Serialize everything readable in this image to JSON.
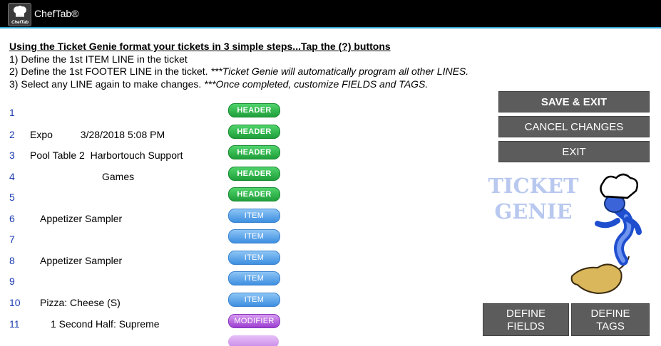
{
  "app": {
    "title": "ChefTab®",
    "icon_label": "ChefTab"
  },
  "instructions": {
    "heading": "Using the Ticket Genie format your tickets in 3 simple steps...Tap the (?) buttons",
    "line1": "1) Define the 1st ITEM LINE in the ticket",
    "line2_main": "2) Define the 1st FOOTER LINE in the ticket. ",
    "line2_italic": "***Ticket Genie will automatically program all other LINES.",
    "line3_main": "3) Select any LINE again to make changes. ",
    "line3_italic": "***Once completed, customize FIELDS and TAGS."
  },
  "rows": [
    {
      "num": "1",
      "text": "",
      "tag": "HEADER"
    },
    {
      "num": "2",
      "text": "Expo          3/28/2018 5:08 PM",
      "tag": "HEADER"
    },
    {
      "num": "3",
      "text": "Pool Table 2  Harbortouch Support",
      "tag": "HEADER"
    },
    {
      "num": "4",
      "text": "Games",
      "tag": "HEADER"
    },
    {
      "num": "5",
      "text": "",
      "tag": "HEADER"
    },
    {
      "num": "6",
      "text": "Appetizer Sampler",
      "tag": "ITEM"
    },
    {
      "num": "7",
      "text": "",
      "tag": "ITEM"
    },
    {
      "num": "8",
      "text": "Appetizer Sampler",
      "tag": "ITEM"
    },
    {
      "num": "9",
      "text": "",
      "tag": "ITEM"
    },
    {
      "num": "10",
      "text": "Pizza: Cheese (S)",
      "tag": "ITEM"
    },
    {
      "num": "11",
      "text": "1 Second Half: Supreme",
      "tag": "MODIFIER"
    }
  ],
  "buttons": {
    "save_exit": "SAVE & EXIT",
    "cancel_changes": "CANCEL CHANGES",
    "exit": "EXIT",
    "define_fields_1": "DEFINE",
    "define_fields_2": "FIELDS",
    "define_tags_1": "DEFINE",
    "define_tags_2": "TAGS"
  },
  "genie": {
    "line1": "TICKET",
    "line2": "GENIE"
  },
  "colors": {
    "header_tag": "#2fb84c",
    "item_tag": "#5aa3ea",
    "modifier_tag": "#b35ee0",
    "row_number": "#1b3bb0",
    "button": "#5c5c5c",
    "titlebar_accent": "#2fa7d6"
  }
}
